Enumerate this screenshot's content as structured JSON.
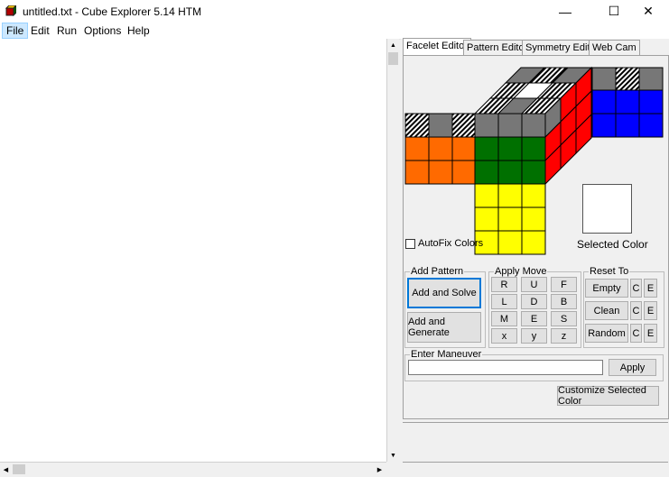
{
  "window": {
    "title": "untitled.txt - Cube Explorer 5.14 HTM"
  },
  "window_controls": {
    "minimize": "—",
    "maximize": "☐",
    "close": "✕"
  },
  "menu": [
    "File",
    "Edit",
    "Run",
    "Options",
    "Help"
  ],
  "tabs": [
    "Facelet Editor",
    "Pattern Editor",
    "Symmetry Editor",
    "Web Cam"
  ],
  "facelet_editor": {
    "autofix_label": "AutoFix Colors",
    "autofix_checked": false,
    "selected_color_label": "Selected Color",
    "selected_color": "#ffffff"
  },
  "cube": {
    "colors": {
      "orange": "#ff6a00",
      "green": "#007000",
      "yellow": "#ffff00",
      "red": "#ff0000",
      "blue": "#0000ff",
      "gray": "#777777",
      "white": "#ffffff"
    },
    "top_grid": [
      [
        "gray",
        "hatch",
        "gray"
      ],
      [
        "hatch",
        "white",
        "hatch"
      ],
      [
        "hatch",
        "gray",
        "hatch"
      ]
    ],
    "left_top_row": [
      "hatch",
      "gray",
      "hatch"
    ],
    "right_top_row": [
      "gray",
      "hatch",
      "gray"
    ]
  },
  "add_pattern": {
    "label": "Add Pattern",
    "add_and_solve": "Add and Solve",
    "add_and_generate": "Add and Generate"
  },
  "apply_move": {
    "label": "Apply Move",
    "buttons": [
      [
        "R",
        "U",
        "F"
      ],
      [
        "L",
        "D",
        "B"
      ],
      [
        "M",
        "E",
        "S"
      ],
      [
        "x",
        "y",
        "z"
      ]
    ]
  },
  "reset_to": {
    "label": "Reset To",
    "rows": [
      {
        "label": "Empty",
        "c": "C",
        "e": "E"
      },
      {
        "label": "Clean",
        "c": "C",
        "e": "E"
      },
      {
        "label": "Random",
        "c": "C",
        "e": "E"
      }
    ]
  },
  "enter_maneuver": {
    "label": "Enter Maneuver",
    "value": "",
    "apply": "Apply"
  },
  "customize_button": "Customize Selected Color"
}
